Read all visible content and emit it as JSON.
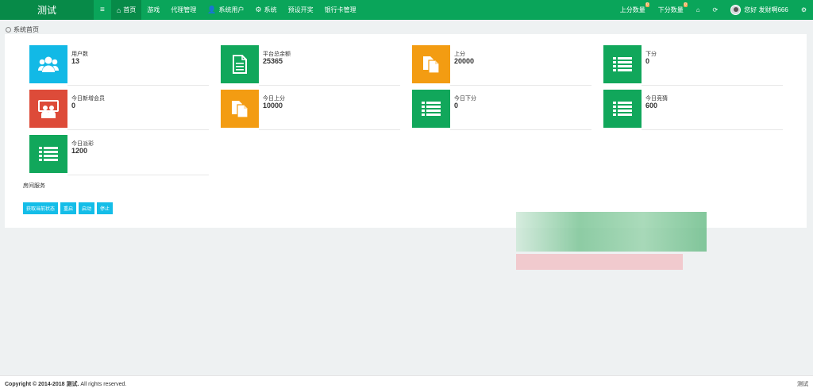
{
  "brand": "测试",
  "nav": {
    "menu_toggle": "≡",
    "items": [
      {
        "label": "首页",
        "icon": "home-icon"
      },
      {
        "label": "游戏"
      },
      {
        "label": "代理管理"
      },
      {
        "label": "系统用户",
        "icon": "user-icon"
      },
      {
        "label": "系统",
        "icon": "gear-icon"
      },
      {
        "label": "预设开奖"
      },
      {
        "label": "银行卡管理"
      }
    ],
    "right": {
      "up_count": "上分数量",
      "up_badge": "0",
      "down_count": "下分数量",
      "down_badge": "0",
      "greeting": "您好 发财啊666"
    }
  },
  "breadcrumb": "系统首页",
  "stats": [
    {
      "label": "用户数",
      "value": "13",
      "color": "#12b9e6",
      "icon": "users-icon"
    },
    {
      "label": "平台总余额",
      "value": "25365",
      "color": "#11a75b",
      "icon": "file-icon"
    },
    {
      "label": "上分",
      "value": "20000",
      "color": "#f39c12",
      "icon": "copy-icon"
    },
    {
      "label": "下分",
      "value": "0",
      "color": "#11a75b",
      "icon": "list-icon"
    },
    {
      "label": "今日新增会员",
      "value": "0",
      "color": "#dd4b39",
      "icon": "group-icon"
    },
    {
      "label": "今日上分",
      "value": "10000",
      "color": "#f39c12",
      "icon": "copy-icon"
    },
    {
      "label": "今日下分",
      "value": "0",
      "color": "#11a75b",
      "icon": "list-icon"
    },
    {
      "label": "今日竞猜",
      "value": "600",
      "color": "#11a75b",
      "icon": "list-icon"
    },
    {
      "label": "今日派彩",
      "value": "1200",
      "color": "#11a75b",
      "icon": "list-icon"
    }
  ],
  "room_service": {
    "title": "房间服务",
    "buttons": [
      "获取当前状态",
      "重启",
      "启动",
      "停止"
    ]
  },
  "footer": {
    "copyright_bold": "Copyright © 2014-2018 测试.",
    "copyright_rest": " All rights reserved.",
    "right": "测试"
  }
}
